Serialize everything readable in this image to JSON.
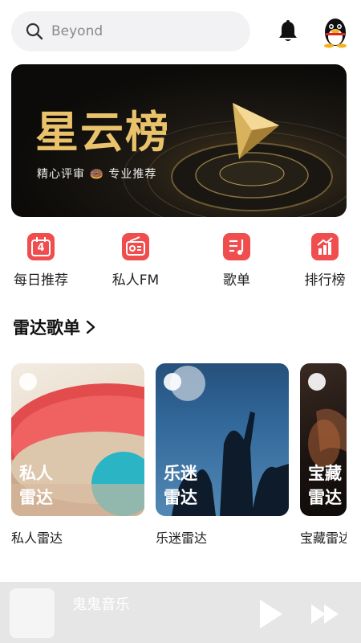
{
  "search": {
    "placeholder": "Beyond",
    "icon": "search-icon"
  },
  "header": {
    "bell_icon": "bell-icon",
    "avatar_icon": "qq-penguin-icon"
  },
  "banner": {
    "title": "星云榜",
    "subtitle": "精心评审 🍩 专业推荐",
    "accent": "#e9c26b"
  },
  "menu": [
    {
      "label": "每日推荐",
      "icon": "calendar-icon",
      "day": "4"
    },
    {
      "label": "私人FM",
      "icon": "radio-icon"
    },
    {
      "label": "歌单",
      "icon": "playlist-icon"
    },
    {
      "label": "排行榜",
      "icon": "ranking-icon"
    }
  ],
  "section": {
    "title": "雷达歌单"
  },
  "cards": [
    {
      "cover": "私人\n雷达",
      "label": "私人雷达"
    },
    {
      "cover": "乐迷\n雷达",
      "label": "乐迷雷达"
    },
    {
      "cover": "宝藏\n雷达",
      "label": "宝藏雷达"
    }
  ],
  "player": {
    "song": "鬼鬼音乐"
  },
  "colors": {
    "brand": "#f04e4e",
    "banner_bg": "#0c0b09",
    "player_bg": "#e6e6e6"
  }
}
